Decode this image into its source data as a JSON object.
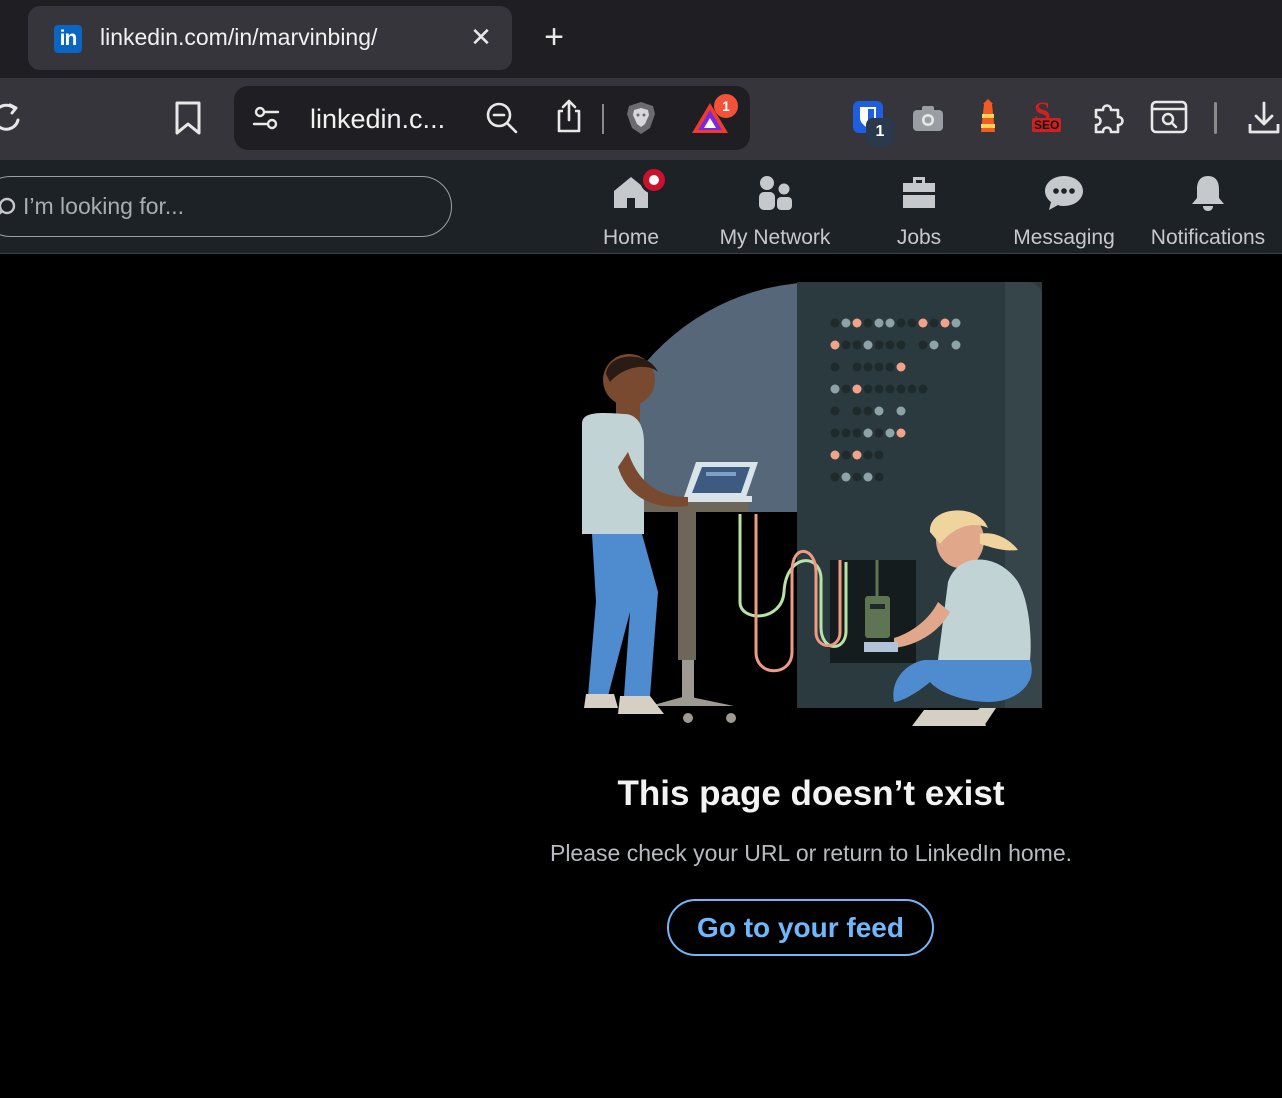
{
  "browser": {
    "tab": {
      "favicon_text": "in",
      "title": "linkedin.com/in/marvinbing/",
      "close_label": "✕"
    },
    "new_tab_label": "+",
    "omnibox": {
      "url_text": "linkedin.c..."
    },
    "badges": {
      "rewards_count": "1",
      "bitwarden_count": "1"
    },
    "seo_ext_text": "SEO"
  },
  "linkedin_nav": {
    "search_placeholder": "I’m looking for...",
    "items": [
      {
        "label": "Home",
        "icon": "home-icon"
      },
      {
        "label": "My Network",
        "icon": "my-network-icon"
      },
      {
        "label": "Jobs",
        "icon": "jobs-icon"
      },
      {
        "label": "Messaging",
        "icon": "messaging-icon"
      },
      {
        "label": "Notifications",
        "icon": "notifications-icon"
      }
    ]
  },
  "main": {
    "title": "This page doesn’t exist",
    "subtitle": "Please check your URL or return to LinkedIn home.",
    "feed_button": "Go to your feed"
  },
  "colors": {
    "accent": "#71b7fb",
    "notification_red": "#cb112d",
    "brave_orange": "#fb542b"
  }
}
